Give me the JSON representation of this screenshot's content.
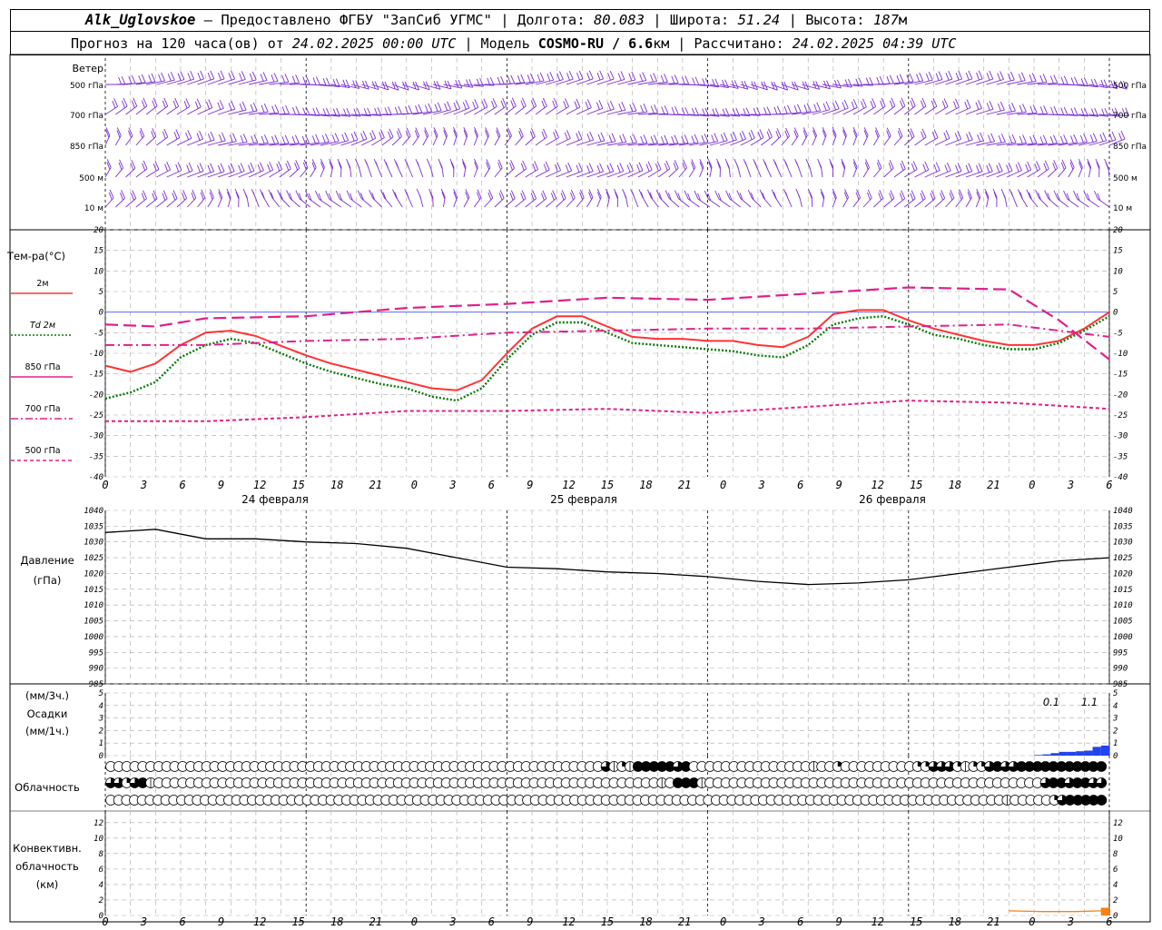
{
  "header": {
    "station": "Alk_Uglovskoe",
    "provider": " — Предоставлено ФГБУ \"ЗапСиб УГМС\" | Долгота: ",
    "lon": "80.083",
    "lat_label": " | Широта: ",
    "lat": "51.24",
    "alt_label": " | Высота: ",
    "alt": "187",
    "alt_unit": "м",
    "forecast_prefix": "Прогноз на 120 часа(ов) от ",
    "init_time": "24.02.2025 00:00 UTC",
    "model_label": "  | Модель ",
    "model": "COSMO-RU / 6.6",
    "model_unit": "км | Рассчитано: ",
    "calc_time": "24.02.2025 04:39 UTC"
  },
  "wind_panel": {
    "title": "Ветер",
    "levels": [
      "500 гПа",
      "700 гПа",
      "850 гПа",
      "500 м",
      "10  м"
    ],
    "color": "#7b2fd6"
  },
  "temp_panel": {
    "title": "Тем-ра(°C)",
    "legend": [
      {
        "label": "2м",
        "color": "#ff3333",
        "dash": "solid"
      },
      {
        "label": "Td  2м",
        "color": "#0a7a0a",
        "dash": "dotted"
      },
      {
        "label": "850 гПа",
        "color": "#e0208a",
        "dash": "long"
      },
      {
        "label": "700 гПа",
        "color": "#e0208a",
        "dash": "dashdot"
      },
      {
        "label": "500 гПа",
        "color": "#e0208a",
        "dash": "short"
      }
    ],
    "yticks": [
      "20",
      "15",
      "10",
      "5",
      "0",
      "-5",
      "-10",
      "-15",
      "-20",
      "-25",
      "-30",
      "-35",
      "-40"
    ]
  },
  "time_axis": {
    "hour_labels": [
      "0",
      "3",
      "6",
      "9",
      "12",
      "15",
      "18",
      "21",
      "0",
      "3",
      "6",
      "9",
      "12",
      "15",
      "18",
      "21",
      "0",
      "3",
      "6",
      "9",
      "12",
      "15",
      "18",
      "21",
      "0",
      "3",
      "6"
    ],
    "days": [
      "24 февраля",
      "25 февраля",
      "26 февраля"
    ]
  },
  "pressure_panel": {
    "title1": "Давление",
    "title2": "(гПа)",
    "yticks": [
      "1040",
      "1035",
      "1030",
      "1025",
      "1020",
      "1015",
      "1010",
      "1005",
      "1000",
      "995",
      "990",
      "985"
    ]
  },
  "precip_panel": {
    "title1": "(мм/3ч.)",
    "title2": "Осадки",
    "title3": "(мм/1ч.)",
    "yticks": [
      "5",
      "4",
      "3",
      "2",
      "1",
      "0"
    ],
    "labels": [
      {
        "hour": 102,
        "text": "0.1"
      },
      {
        "hour": 111,
        "text": "1.1"
      }
    ],
    "color": "#2244ee"
  },
  "cloud_panel": {
    "title": "Облачность"
  },
  "conv_panel": {
    "title1": "Конвективн.",
    "title2": "облачность",
    "title3": "(км)",
    "yticks": [
      "12",
      "10",
      "8",
      "6",
      "4",
      "2",
      "0"
    ],
    "color": "#ff7f10"
  },
  "chart_data": [
    {
      "type": "line",
      "title": "Тем-ра(°C)",
      "x_unit": "hours from 24.02.2025 00:00 UTC",
      "ylim": [
        -40,
        20
      ],
      "series": [
        {
          "name": "2м",
          "x": [
            0,
            3,
            6,
            9,
            12,
            15,
            18,
            21,
            24,
            27,
            30,
            33,
            36,
            39,
            42,
            45,
            48,
            51,
            54,
            57,
            60,
            63,
            66,
            69,
            72,
            75,
            78,
            81,
            84,
            87,
            90,
            93,
            96,
            99,
            102,
            105,
            108,
            111,
            114,
            117,
            120
          ],
          "values": [
            -13,
            -14.5,
            -12.5,
            -8,
            -5,
            -4.5,
            -5.8,
            -8.2,
            -10.5,
            -12.5,
            -14,
            -15.5,
            -17,
            -18.5,
            -19,
            -16.5,
            -10,
            -4,
            -1,
            -1,
            -3.5,
            -6,
            -6.5,
            -6.5,
            -7,
            -7,
            -8,
            -8.5,
            -6,
            -0.5,
            0.5,
            0.5,
            -2,
            -4,
            -5.5,
            -7,
            -8,
            -8,
            -7,
            -4,
            0
          ]
        },
        {
          "name": "Td  2м",
          "x": [
            0,
            3,
            6,
            9,
            12,
            15,
            18,
            21,
            24,
            27,
            30,
            33,
            36,
            39,
            42,
            45,
            48,
            51,
            54,
            57,
            60,
            63,
            66,
            69,
            72,
            75,
            78,
            81,
            84,
            87,
            90,
            93,
            96,
            99,
            102,
            105,
            108,
            111,
            114,
            117,
            120
          ],
          "values": [
            -21,
            -19.5,
            -17,
            -11,
            -8,
            -6.5,
            -7.5,
            -10,
            -12.5,
            -14.5,
            -16,
            -17.5,
            -18.5,
            -20.5,
            -21.5,
            -18.5,
            -11.5,
            -5.5,
            -2.5,
            -2.5,
            -5,
            -7.5,
            -8,
            -8.5,
            -9,
            -9.5,
            -10.5,
            -11,
            -8,
            -3,
            -1.5,
            -1,
            -3,
            -5.5,
            -6.5,
            -8,
            -9,
            -9,
            -7.5,
            -4.5,
            -1
          ]
        },
        {
          "name": "850 гПа",
          "x": [
            0,
            6,
            12,
            24,
            36,
            48,
            60,
            72,
            84,
            96,
            108,
            114,
            120
          ],
          "values": [
            -3,
            -3.5,
            -1.5,
            -1,
            1,
            2,
            3.5,
            3,
            4.5,
            6,
            5.5,
            -2,
            -11.5
          ]
        },
        {
          "name": "700 гПа",
          "x": [
            0,
            12,
            24,
            36,
            48,
            60,
            72,
            84,
            96,
            108,
            120
          ],
          "values": [
            -8,
            -8,
            -7,
            -6.5,
            -5,
            -4.5,
            -4,
            -4,
            -3.5,
            -3,
            -6
          ]
        },
        {
          "name": "500 гПа",
          "x": [
            0,
            12,
            24,
            36,
            48,
            60,
            72,
            84,
            96,
            108,
            120
          ],
          "values": [
            -26.5,
            -26.5,
            -25.5,
            -24,
            -24,
            -23.5,
            -24.5,
            -23,
            -21.5,
            -22,
            -23.5
          ]
        }
      ]
    },
    {
      "type": "line",
      "title": "Давление (гПа)",
      "x_unit": "hours from 24.02.2025 00:00 UTC",
      "ylim": [
        985,
        1040
      ],
      "series": [
        {
          "name": "",
          "x": [
            0,
            6,
            12,
            18,
            24,
            30,
            36,
            42,
            48,
            54,
            60,
            66,
            72,
            78,
            84,
            90,
            96,
            102,
            108,
            114,
            120
          ],
          "values": [
            1033,
            1034,
            1031,
            1031,
            1030,
            1029.5,
            1028,
            1025,
            1022,
            1021.5,
            1020.5,
            1020,
            1019,
            1017.5,
            1016.5,
            1017,
            1018,
            1020,
            1022,
            1024,
            1025
          ]
        }
      ]
    },
    {
      "type": "bar",
      "title": "Осадки",
      "x_unit": "hours from 24.02.2025 00:00 UTC",
      "ylim": [
        0,
        5
      ],
      "series": [
        {
          "name": "",
          "x": [
            112,
            113,
            114,
            115,
            116,
            117,
            118,
            119,
            120
          ],
          "values": [
            0.05,
            0.1,
            0.2,
            0.3,
            0.3,
            0.35,
            0.4,
            0.7,
            0.8
          ]
        }
      ]
    },
    {
      "type": "line",
      "title": "Конвективн. облачность (км)",
      "x_unit": "hours from 24.02.2025 00:00 UTC",
      "ylim": [
        0,
        12
      ],
      "series": [
        {
          "name": "",
          "x": [
            108,
            112,
            116,
            119,
            120
          ],
          "values": [
            0.6,
            0.5,
            0.5,
            0.6,
            1
          ]
        }
      ]
    }
  ],
  "cloud_data": {
    "rows": [
      [
        0,
        0,
        0,
        0,
        0,
        0,
        0,
        0,
        0,
        0,
        0,
        0,
        0,
        0,
        0,
        0,
        0,
        0,
        0,
        0,
        0,
        0,
        0,
        0,
        0,
        0,
        0,
        0,
        0,
        0,
        0,
        0,
        0,
        0,
        0,
        0,
        0,
        0,
        0,
        0,
        0,
        0,
        0,
        0,
        0,
        0,
        0,
        0,
        0,
        0,
        0,
        0,
        0,
        0,
        0,
        0,
        0,
        0,
        0,
        0,
        0,
        0,
        3,
        1,
        2,
        1,
        4,
        4,
        4,
        4,
        4,
        3,
        4,
        0,
        0,
        0,
        0,
        0,
        0,
        0,
        0,
        0,
        0,
        0,
        0,
        0,
        0,
        0,
        1,
        0,
        0,
        2,
        0,
        0,
        0,
        0,
        0,
        0,
        0,
        0,
        0,
        2,
        2,
        3,
        3,
        3,
        2,
        1,
        2,
        2,
        3,
        4,
        3,
        3,
        4,
        4,
        4,
        4,
        4,
        4,
        4,
        4,
        4,
        4,
        4
      ],
      [
        3,
        3,
        2,
        3,
        4,
        1,
        0,
        0,
        0,
        0,
        0,
        0,
        0,
        0,
        0,
        0,
        0,
        0,
        0,
        0,
        0,
        0,
        0,
        0,
        0,
        0,
        0,
        0,
        0,
        0,
        0,
        0,
        0,
        0,
        0,
        0,
        0,
        0,
        0,
        0,
        0,
        0,
        0,
        0,
        0,
        0,
        0,
        0,
        0,
        0,
        0,
        0,
        0,
        0,
        0,
        0,
        0,
        0,
        0,
        0,
        0,
        0,
        0,
        0,
        0,
        0,
        0,
        0,
        0,
        1,
        0,
        4,
        4,
        4,
        1,
        0,
        0,
        0,
        0,
        0,
        0,
        0,
        0,
        0,
        0,
        0,
        0,
        0,
        0,
        0,
        0,
        0,
        0,
        0,
        0,
        0,
        0,
        0,
        0,
        0,
        0,
        0,
        0,
        0,
        0,
        0,
        0,
        0,
        0,
        0,
        0,
        0,
        0,
        0,
        0,
        0,
        0,
        3,
        4,
        4,
        3,
        4,
        4,
        3,
        3
      ],
      [
        0,
        0,
        0,
        0,
        0,
        0,
        0,
        0,
        0,
        0,
        0,
        0,
        0,
        0,
        0,
        0,
        0,
        0,
        0,
        0,
        0,
        0,
        0,
        0,
        0,
        0,
        0,
        0,
        0,
        0,
        0,
        0,
        0,
        0,
        0,
        0,
        0,
        0,
        0,
        0,
        0,
        0,
        0,
        0,
        0,
        0,
        0,
        0,
        0,
        0,
        0,
        0,
        0,
        0,
        0,
        0,
        0,
        0,
        0,
        0,
        0,
        0,
        0,
        0,
        0,
        0,
        0,
        0,
        0,
        0,
        0,
        0,
        0,
        0,
        0,
        0,
        0,
        0,
        0,
        0,
        0,
        0,
        0,
        0,
        0,
        0,
        0,
        0,
        0,
        0,
        0,
        0,
        0,
        0,
        0,
        0,
        0,
        0,
        0,
        0,
        0,
        0,
        0,
        0,
        0,
        0,
        0,
        0,
        0,
        0,
        0,
        0,
        0,
        0,
        1,
        0,
        0,
        0,
        0,
        0,
        2,
        3,
        4,
        4,
        4,
        4,
        4
      ]
    ]
  }
}
